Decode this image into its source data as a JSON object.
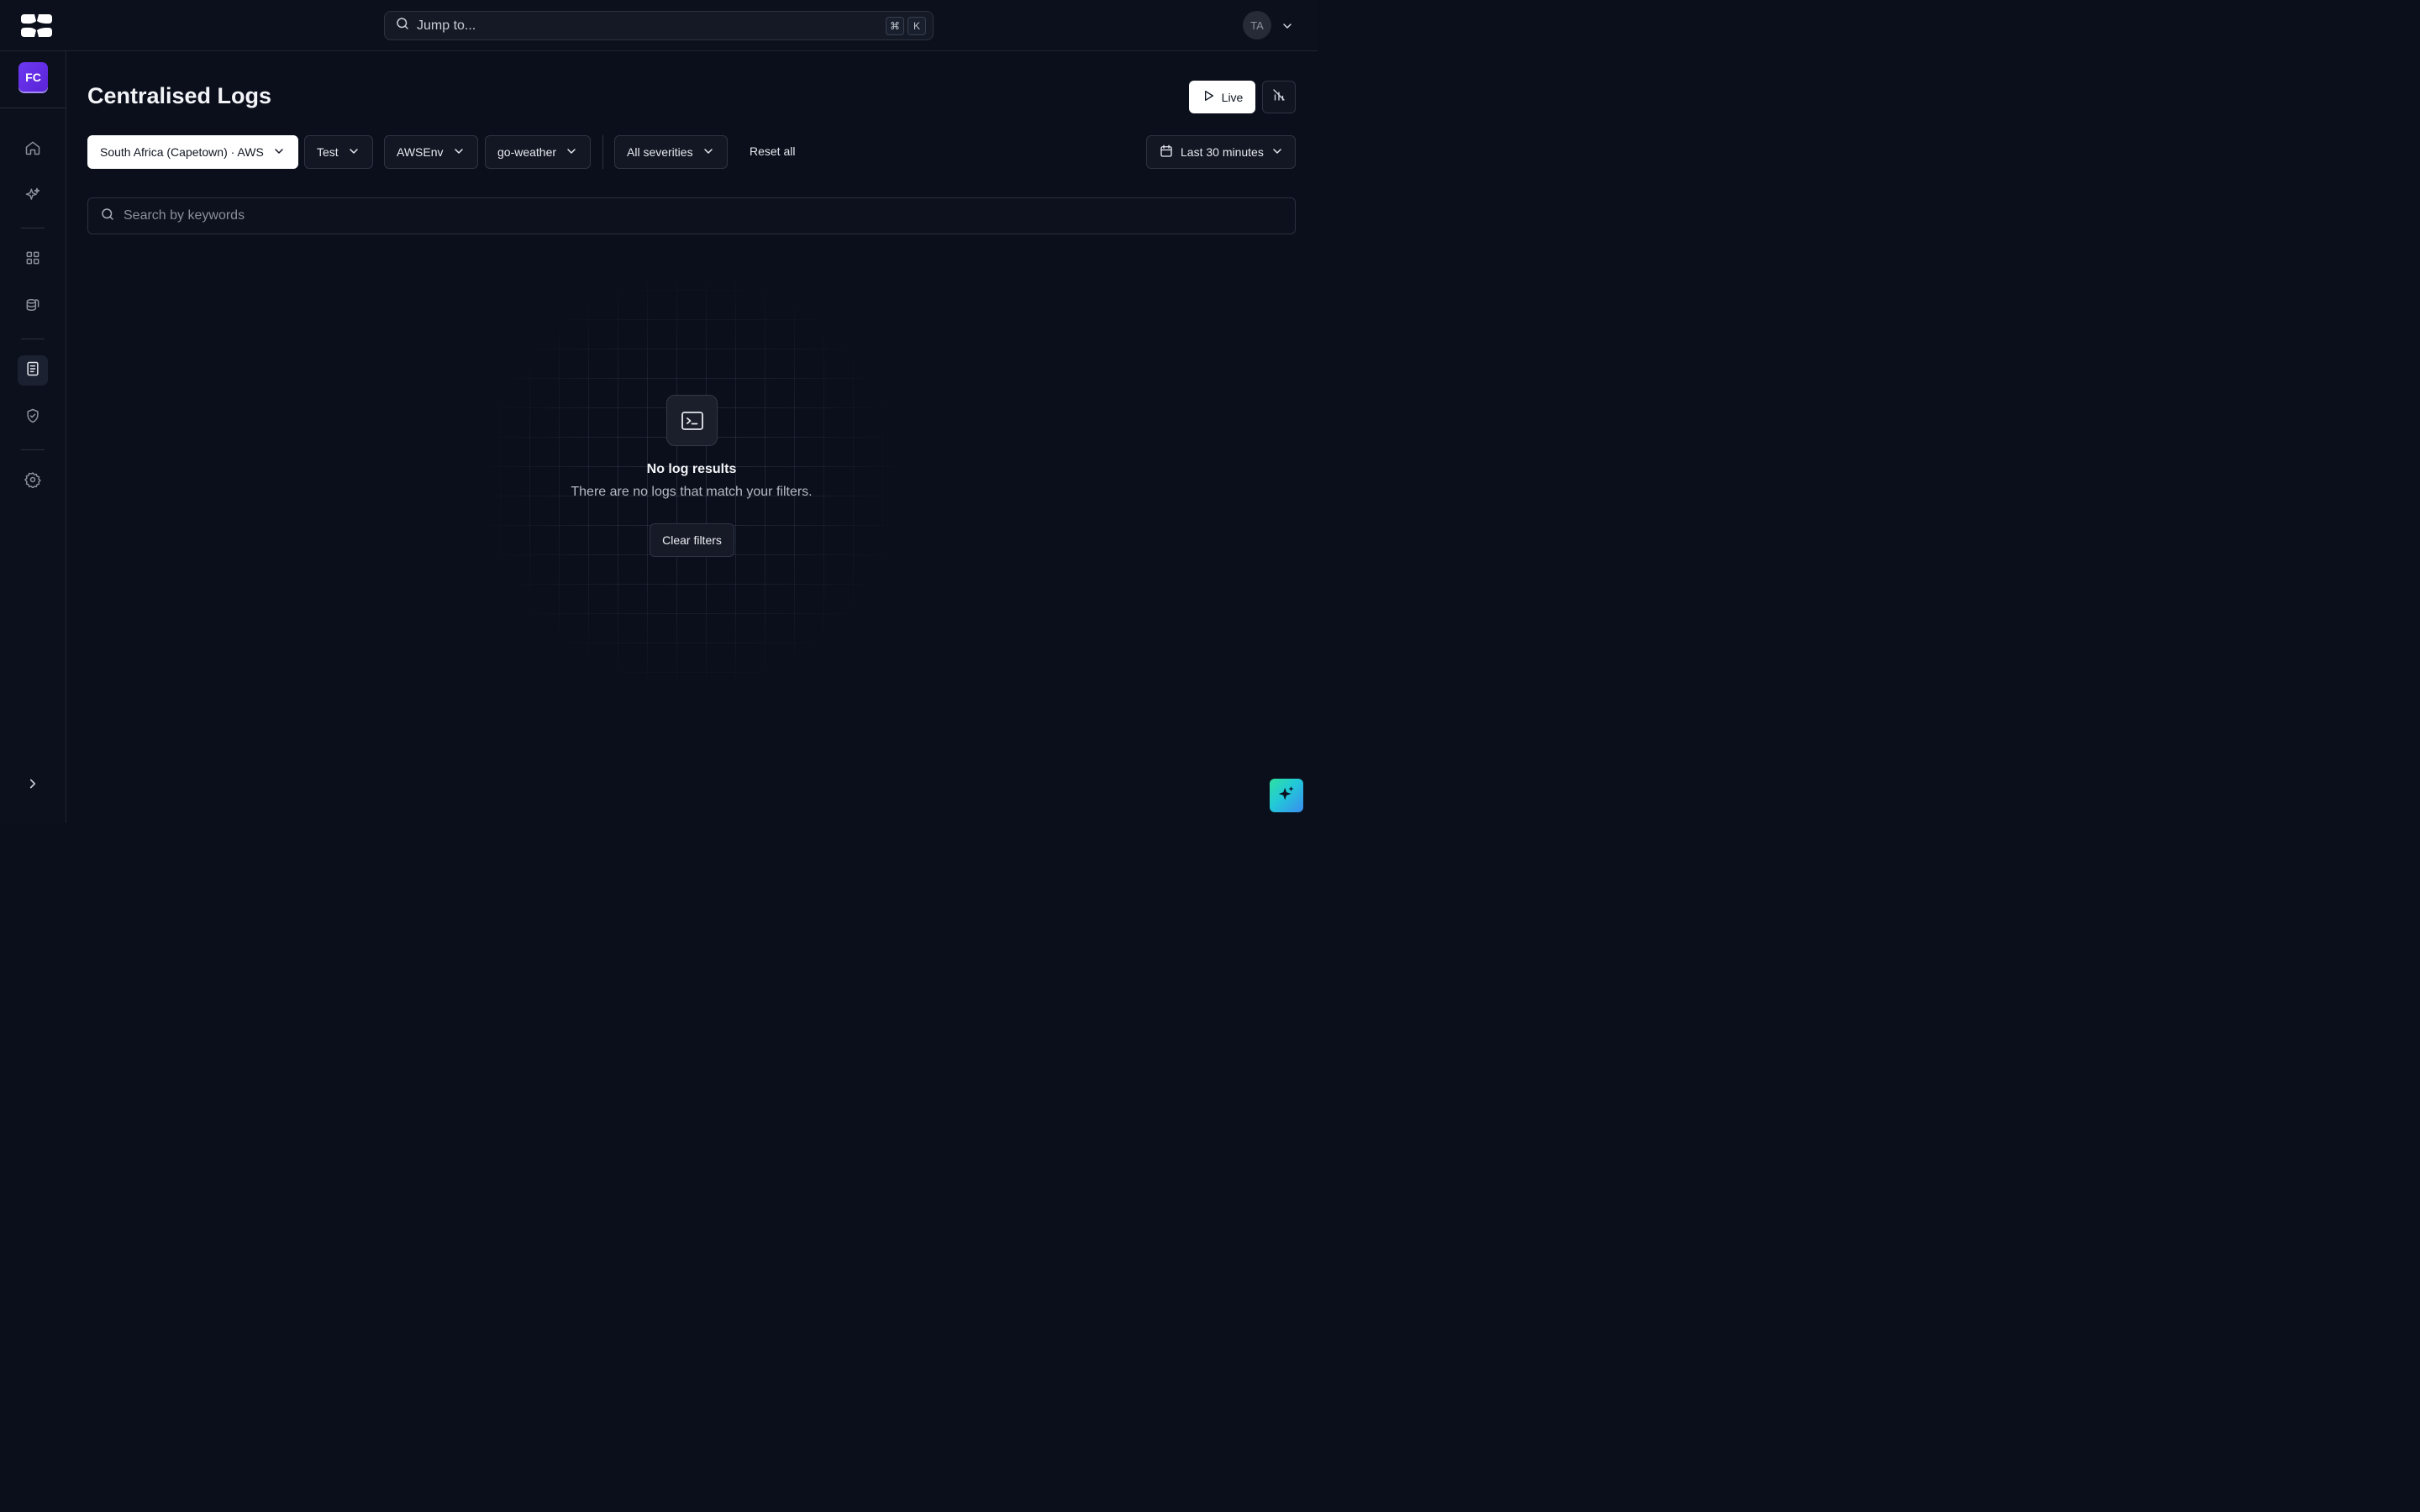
{
  "topbar": {
    "search_placeholder": "Jump to...",
    "shortcut_keys": [
      "⌘",
      "K"
    ],
    "user_initials": "TA"
  },
  "sidebar": {
    "org_initials": "FC",
    "items": [
      {
        "icon": "home-icon"
      },
      {
        "icon": "sparkles-icon"
      },
      {
        "icon": "grid-icon"
      },
      {
        "icon": "database-icon"
      },
      {
        "icon": "logs-icon",
        "active": true
      },
      {
        "icon": "shield-check-icon"
      },
      {
        "icon": "gear-icon"
      }
    ]
  },
  "page": {
    "title": "Centralised Logs",
    "live_label": "Live"
  },
  "filters": {
    "region": "South Africa (Capetown) · AWS",
    "environment": "Test",
    "account": "AWSEnv",
    "service": "go-weather",
    "severity": "All severities",
    "reset_label": "Reset all",
    "time_range": "Last 30 minutes"
  },
  "search": {
    "placeholder": "Search by keywords"
  },
  "empty_state": {
    "title": "No log results",
    "subtitle": "There are no logs that match your filters.",
    "clear_label": "Clear filters"
  },
  "colors": {
    "background": "#0a0f1b",
    "org_accent": "#6c38f2"
  }
}
